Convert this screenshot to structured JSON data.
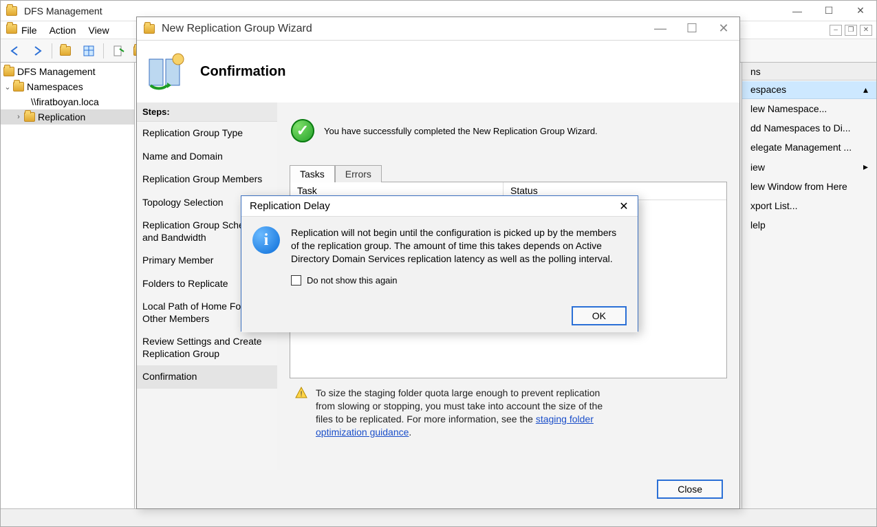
{
  "main": {
    "title": "DFS Management",
    "menu": {
      "file": "File",
      "action": "Action",
      "view": "View"
    }
  },
  "tree": {
    "root": "DFS Management",
    "namespaces": "Namespaces",
    "ns_item": "\\\\firatboyan.loca",
    "replication": "Replication"
  },
  "actions": {
    "header": "ns",
    "sub": "espaces",
    "new_ns": "lew Namespace...",
    "add_ns": "dd Namespaces to Di...",
    "delegate": "elegate Management ...",
    "view": "iew",
    "new_win": "lew Window from Here",
    "export": "xport List...",
    "help": "lelp"
  },
  "wizard": {
    "title": "New Replication Group Wizard",
    "heading": "Confirmation",
    "steps_label": "Steps:",
    "steps": [
      "Replication Group Type",
      "Name and Domain",
      "Replication Group Members",
      "Topology Selection",
      "Replication Group Schedule and Bandwidth",
      "Primary Member",
      "Folders to Replicate",
      "Local Path of Home Folder on Other Members",
      "Review Settings and Create Replication Group",
      "Confirmation"
    ],
    "success_msg": "You have successfully completed the New Replication Group Wizard.",
    "tabs": {
      "tasks": "Tasks",
      "errors": "Errors"
    },
    "cols": {
      "task": "Task",
      "status": "Status"
    },
    "hint_pre": "To size the staging folder quota large enough to prevent replication from slowing or stopping, you must take into account the size of the files to be replicated. For more information, see the ",
    "hint_link": "staging folder optimization guidance",
    "close": "Close"
  },
  "dialog": {
    "title": "Replication Delay",
    "body": "Replication will not begin until the configuration is picked up by the members of the replication group. The amount of time this takes depends on Active Directory Domain Services replication latency as well as the polling interval.",
    "checkbox": "Do not show this again",
    "ok": "OK"
  }
}
